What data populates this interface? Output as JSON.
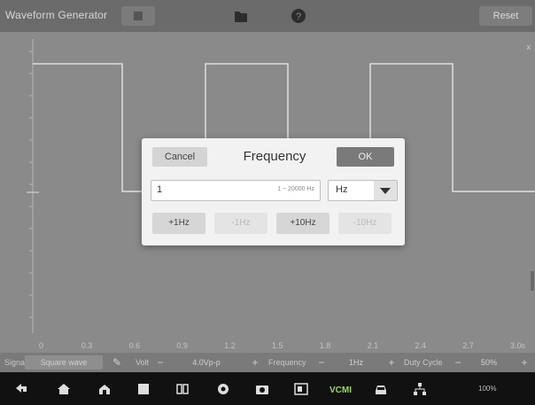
{
  "header": {
    "title": "Waveform Generator",
    "reset_label": "Reset"
  },
  "plot": {
    "x_ticks": [
      "0",
      "0.3",
      "0.6",
      "0.9",
      "1.2",
      "1.5",
      "1.8",
      "2.1",
      "2.4",
      "2.7",
      "3.0s"
    ]
  },
  "controls": {
    "signal_label": "Signal",
    "signal_value": "Square wave",
    "volt_label": "Volt",
    "volt_value": "4.0Vp-p",
    "frequency_label": "Frequency",
    "frequency_value": "1Hz",
    "duty_label": "Duty Cycle",
    "duty_value": "50%",
    "minus": "−",
    "plus": "+"
  },
  "dialog": {
    "cancel_label": "Cancel",
    "title": "Frequency",
    "ok_label": "OK",
    "input_value": "1",
    "input_range": "1 ~ 20000 Hz",
    "unit_value": "Hz",
    "steps": [
      "+1Hz",
      "-1Hz",
      "+10Hz",
      "-10Hz"
    ]
  },
  "status": {
    "text": "100%"
  },
  "icons": [
    "back-icon",
    "home-icon",
    "house-icon",
    "recents-icon",
    "split-icon",
    "browser-icon",
    "camera-icon",
    "screen-icon",
    "vcmi-icon",
    "car-icon",
    "network-icon"
  ],
  "colors": {
    "ok_button": "#7a7a7a",
    "waveform": "#e0e0e0"
  }
}
